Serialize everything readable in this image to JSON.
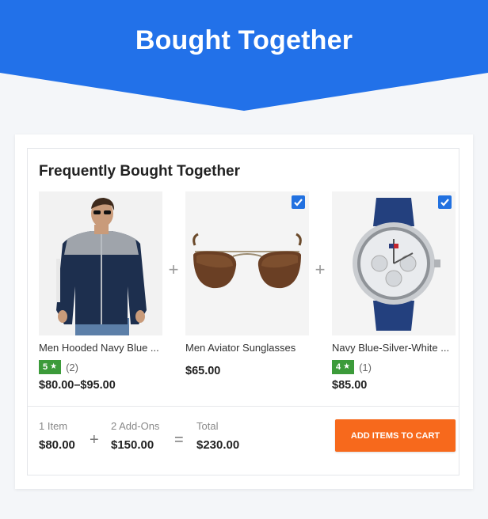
{
  "banner": {
    "title": "Bought Together"
  },
  "section": {
    "title": "Frequently Bought Together"
  },
  "products": [
    {
      "name": "Men Hooded Navy Blue ...",
      "rating": "5",
      "rating_count": "(2)",
      "price": "$80.00–$95.00",
      "checked": false
    },
    {
      "name": "Men Aviator Sunglasses",
      "price": "$65.00",
      "checked": true
    },
    {
      "name": "Navy Blue-Silver-White ...",
      "rating": "4",
      "rating_count": "(1)",
      "price": "$85.00",
      "checked": true
    }
  ],
  "summary": {
    "items_label": "1 Item",
    "items_value": "$80.00",
    "addons_label": "2 Add-Ons",
    "addons_value": "$150.00",
    "total_label": "Total",
    "total_value": "$230.00",
    "plus": "+",
    "equals": "="
  },
  "operators": {
    "plus": "+"
  },
  "rating_star": "★",
  "cart_button": {
    "label": "ADD ITEMS TO CART"
  },
  "colors": {
    "banner": "#2271e9",
    "accent": "#f7691c",
    "rating": "#3c9b3a",
    "checkbox": "#2271e0"
  }
}
